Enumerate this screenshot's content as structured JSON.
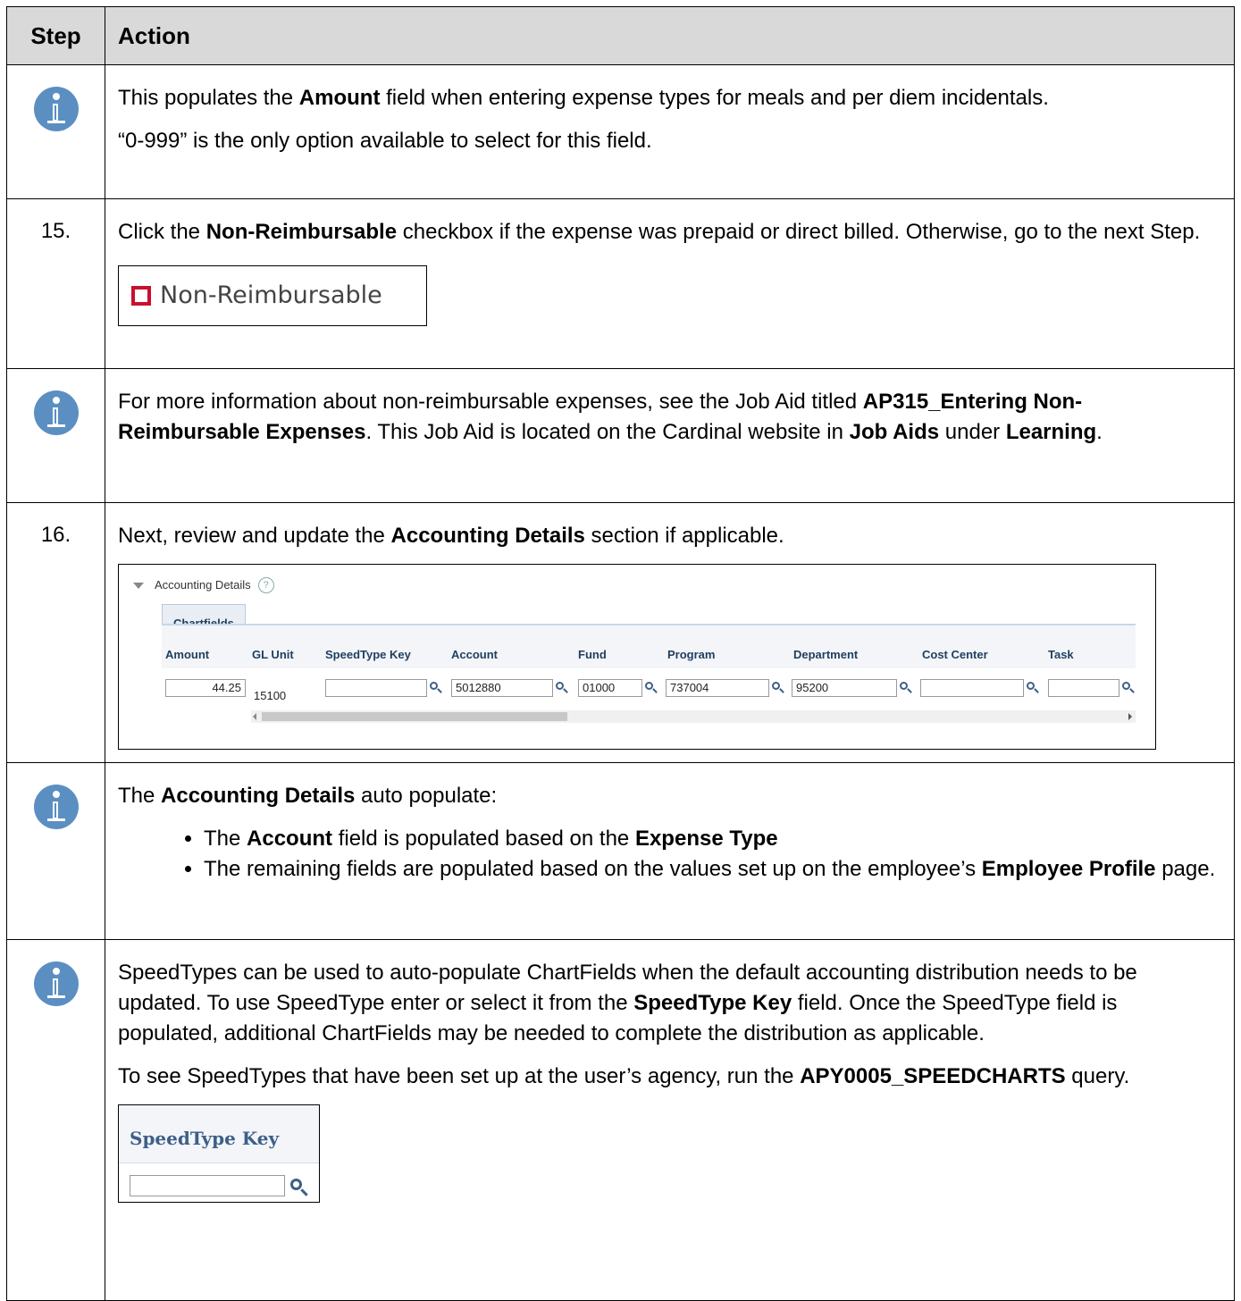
{
  "header": {
    "step": "Step",
    "action": "Action"
  },
  "rows": {
    "r1": {
      "p1a": "This populates the ",
      "p1b": "Amount",
      "p1c": " field when entering expense types for meals and per diem incidentals.",
      "p2": "“0-999” is the only option available to select for this field."
    },
    "r2": {
      "step": "15.",
      "p1a": "Click the ",
      "p1b": "Non-Reimbursable",
      "p1c": " checkbox if the expense was prepaid or direct billed.  Otherwise, go to the next Step.",
      "checkbox_label": "Non-Reimbursable"
    },
    "r3": {
      "p1a": "For more information about non-reimbursable expenses, see the Job Aid titled ",
      "p1b": "AP315_Entering Non-Reimbursable Expenses",
      "p1c": ".  This Job Aid is located on the Cardinal website in ",
      "p1d": "Job Aids",
      "p1e": " under ",
      "p1f": "Learning",
      "p1g": "."
    },
    "r4": {
      "step": "16.",
      "p1a": "Next, review and update the ",
      "p1b": "Accounting Details",
      "p1c": " section if applicable.",
      "panel": {
        "title": "Accounting Details",
        "help": "?",
        "tab": "Chartfields",
        "columns": [
          "Amount",
          "GL Unit",
          "SpeedType Key",
          "Account",
          "Fund",
          "Program",
          "Department",
          "Cost Center",
          "Task"
        ],
        "values": {
          "amount": "44.25",
          "gl_unit": "15100",
          "speedtype_key": "",
          "account": "5012880",
          "fund": "01000",
          "program": "737004",
          "department": "95200",
          "cost_center": "",
          "task": ""
        }
      }
    },
    "r5": {
      "p1a": "The ",
      "p1b": "Accounting Details",
      "p1c": " auto populate:",
      "b1a": "The ",
      "b1b": "Account",
      "b1c": " field is populated based on the ",
      "b1d": "Expense Type",
      "b2a": "The remaining fields are populated based on the values set up on the employee’s ",
      "b2b": "Employee Profile",
      "b2c": " page."
    },
    "r6": {
      "p1a": "SpeedTypes can be used to auto-populate ChartFields when the default accounting distribution needs to be updated.  To use SpeedType enter or select it from the ",
      "p1b": "SpeedType Key",
      "p1c": " field.  Once the SpeedType field is populated, additional ChartFields may be needed to complete the distribution as applicable.",
      "p2a": "To see SpeedTypes that have been set up at the user’s agency, run the ",
      "p2b": "APY0005_SPEEDCHARTS",
      "p2c": " query.",
      "field_label": "SpeedType Key"
    }
  },
  "icons": {
    "info": "info-icon",
    "lookup": "magnifier-icon"
  },
  "colors": {
    "header_bg": "#d9d9d9",
    "info_icon": "#5b8fc1",
    "checkbox_border": "#c8102e"
  }
}
